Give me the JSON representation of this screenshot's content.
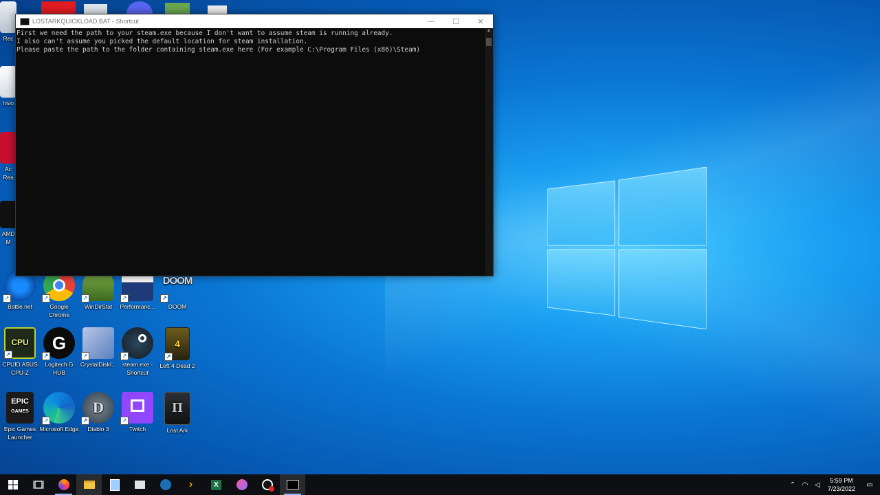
{
  "desktop": {
    "icons": [
      {
        "label": "Battle.net",
        "icon": "battlenet-icon"
      },
      {
        "label": "Google Chrome",
        "icon": "chrome-icon"
      },
      {
        "label": "WinDirStat",
        "icon": "windirstat-icon"
      },
      {
        "label": "Performanc...",
        "icon": "performance-icon"
      },
      {
        "label": "DOOM",
        "icon": "doom-icon"
      },
      {
        "label": "CPUID ASUS CPU-Z",
        "icon": "cpuz-icon"
      },
      {
        "label": "Logitech G HUB",
        "icon": "logitech-icon"
      },
      {
        "label": "CrystalDiskI...",
        "icon": "crystaldisk-icon"
      },
      {
        "label": "steam.exe - Shortcut",
        "icon": "steam-icon"
      },
      {
        "label": "Left 4 Dead 2",
        "icon": "left4dead-icon"
      },
      {
        "label": "Epic Games Launcher",
        "icon": "epic-icon"
      },
      {
        "label": "Microsoft Edge",
        "icon": "edge-icon"
      },
      {
        "label": "Diablo 3",
        "icon": "diablo-icon"
      },
      {
        "label": "Twitch",
        "icon": "twitch-icon"
      },
      {
        "label": "Lost Ark",
        "icon": "lostark-icon"
      }
    ],
    "partial_labels": [
      "Rec",
      "Invo",
      "Ac Rea",
      "AMD M"
    ]
  },
  "cmd_window": {
    "title": "LOSTARKQUICKLOAD.BAT - Shortcut",
    "lines": [
      "First we need the path to your steam.exe because I don't want to assume steam is running already.",
      "I also can't assume you picked the default location for steam installation.",
      "Please paste the path to the folder containing steam.exe here (For example C:\\Program Files (x86)\\Steam)"
    ]
  },
  "taskbar": {
    "apps": [
      "start-icon",
      "task-view-icon",
      "firefox-icon",
      "file-explorer-icon",
      "notepad-icon",
      "files-icon",
      "steam-icon",
      "plex-icon",
      "excel-icon",
      "itunes-icon",
      "obs-icon",
      "cmd-icon"
    ],
    "clock_time": "5:59 PM",
    "clock_date": "7/23/2022"
  },
  "colors": {
    "accent": "#1aa0f2",
    "taskbar": "#0e0f12",
    "console_bg": "#0c0c0c"
  }
}
